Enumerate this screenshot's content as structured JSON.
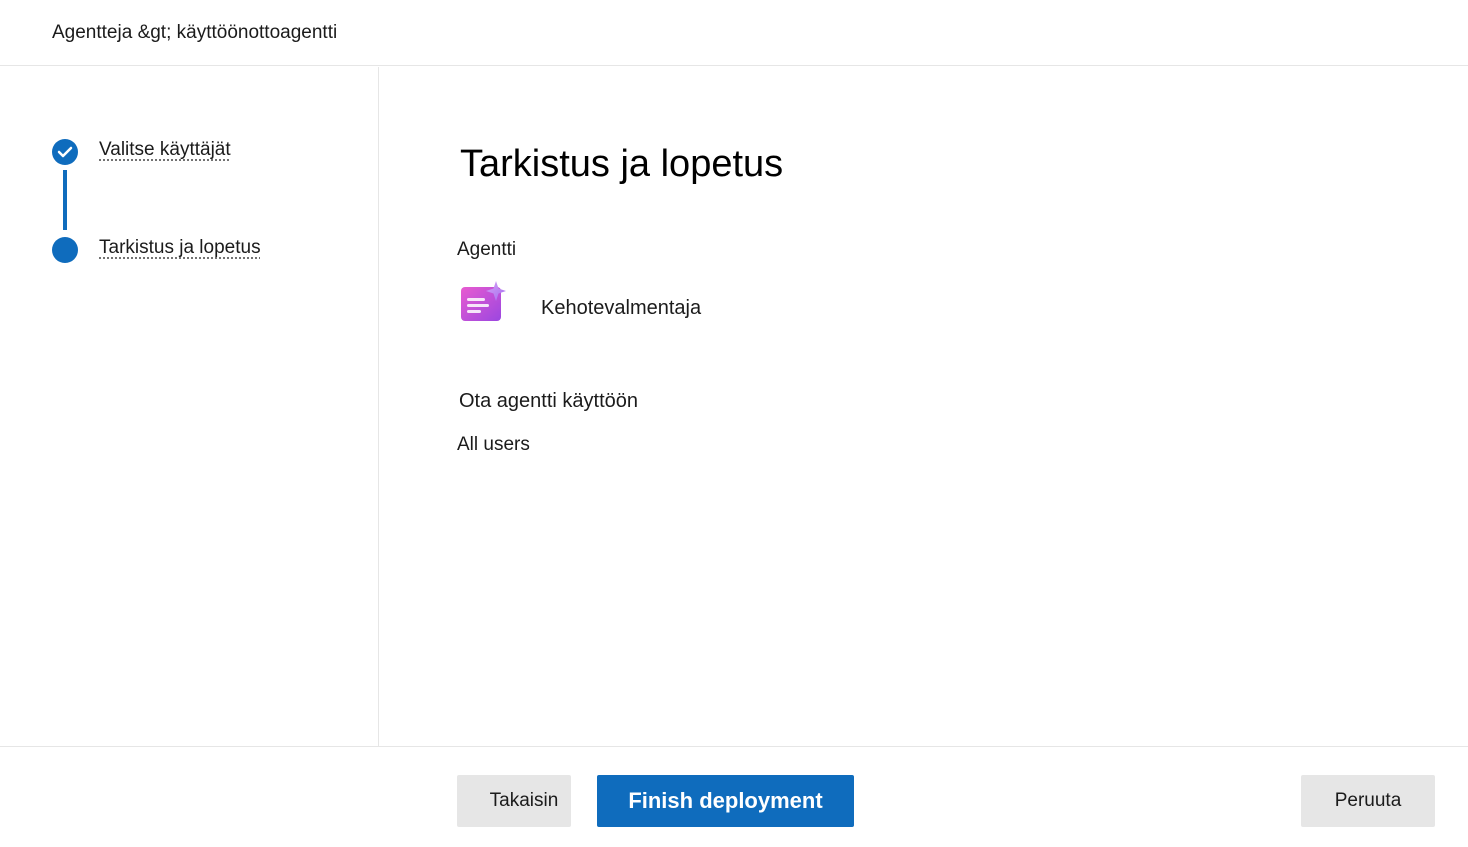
{
  "header": {
    "breadcrumb": "Agentteja &gt; käyttöönottoagentti"
  },
  "steps": [
    {
      "label": "Valitse käyttäjät",
      "status": "completed"
    },
    {
      "label": "Tarkistus ja lopetus",
      "status": "current"
    }
  ],
  "main": {
    "title": "Tarkistus ja lopetus",
    "agent_section_label": "Agentti",
    "agent_name": "Kehotevalmentaja",
    "agent_icon": "prompt-coach-icon",
    "deploy_section_label": "Ota agentti käyttöön",
    "deploy_value": "All users"
  },
  "footer": {
    "back_label": "Takaisin",
    "finish_label": "Finish deployment",
    "cancel_label": "Peruuta"
  },
  "colors": {
    "accent": "#0f6cbd",
    "secondary_button": "#e6e6e6"
  }
}
